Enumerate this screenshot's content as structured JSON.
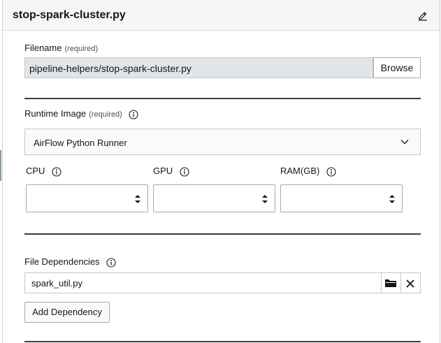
{
  "header": {
    "title": "stop-spark-cluster.py",
    "edit_icon": "pencil-icon"
  },
  "filename": {
    "label": "Filename",
    "required": "(required)",
    "value": "pipeline-helpers/stop-spark-cluster.py",
    "browse_label": "Browse"
  },
  "runtime": {
    "label": "Runtime Image",
    "required": "(required)",
    "info_icon": "info-icon",
    "selected": "AirFlow Python Runner"
  },
  "resources": {
    "cpu_label": "CPU",
    "gpu_label": "GPU",
    "ram_label": "RAM(GB)",
    "cpu_value": "",
    "gpu_value": "",
    "ram_value": ""
  },
  "dependencies": {
    "label": "File Dependencies",
    "items": [
      {
        "value": "spark_util.py"
      }
    ],
    "add_label": "Add Dependency",
    "folder_icon": "folder-icon",
    "remove_icon": "close-icon"
  },
  "colors": {
    "header_bg": "#f4f6f8",
    "readonly_input_bg": "#e2e5e8",
    "divider": "#3d3d3d"
  }
}
